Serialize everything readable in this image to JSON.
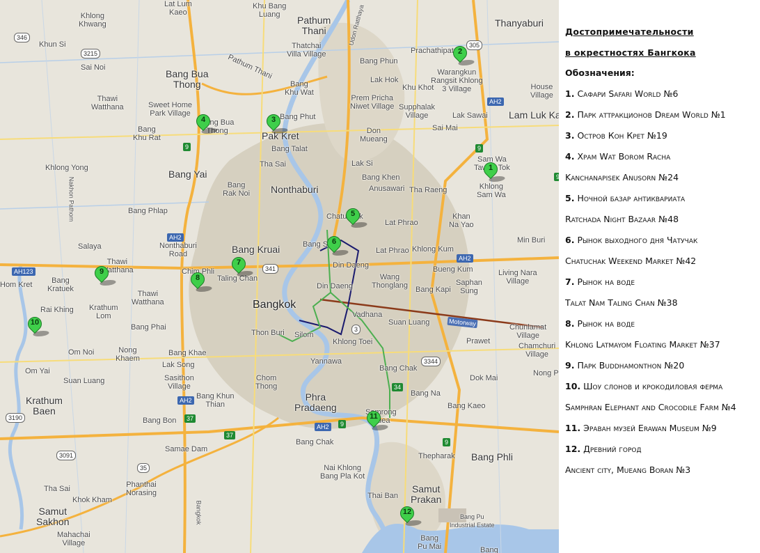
{
  "map": {
    "labels": {
      "lat_lum_kaeo": "Lat Lum\nKaeo",
      "khu_bang_luang": "Khu Bang\nLuang",
      "pathum_thani": "Pathum\nThani",
      "thanyaburi": "Thanyaburi",
      "khlong_khwang": "Khlong\nKhwang",
      "khun_si": "Khun Si",
      "sai_noi": "Sai Noi",
      "thatchai": "Thatchai\nVilla Village",
      "prachathipat": "Prachathipat",
      "bang_bua_thong_1": "Bang Bua\nThong",
      "pathum_thani_road": "Pathum Thani",
      "bang_phun": "Bang Phun",
      "warangkun": "Warangkun\nRangsit Khlong\n3 Village",
      "thawi_watthana_1": "Thawi\nWatthana",
      "sweet_home": "Sweet Home\nPark Village",
      "bang_khu_wat": "Bang\nKhu Wat",
      "lak_hok": "Lak Hok",
      "khu_khot": "Khu Khot",
      "house_village": "House\nVillage",
      "prem_pricha": "Prem Pricha\nNiwet Village",
      "supphalak": "Supphalak\nVillage",
      "lam_luk_ka": "Lam Luk Ka",
      "bang_bua_thong_2": "Bang Bua\nThong",
      "bang_phut": "Bang Phut",
      "pak_kret": "Pak Kret",
      "lak_sawai": "Lak Sawai",
      "bang_khu_rat": "Bang\nKhu Rat",
      "don_mueang": "Don\nMueang",
      "sai_mai": "Sai Mai",
      "bang_talat": "Bang Talat",
      "lak_si": "Lak Si",
      "sam_wa_tawan": "Sam Wa\nTawan Tok",
      "khlong_yong": "Khlong Yong",
      "tha_sai": "Tha Sai",
      "bang_khen": "Bang Khen",
      "bang_yai": "Bang Yai",
      "nonthaburi": "Nonthaburi",
      "anusawari": "Anusawari",
      "khlong_sam_wa": "Khlong\nSam Wa",
      "bang_rak_noi": "Bang\nRak Noi",
      "tha_raeng": "Tha Raeng",
      "bang_phlap": "Bang Phlap",
      "chatuchak": "Chatuchak",
      "lat_phrao_1": "Lat Phrao",
      "khan_na_yao": "Khan\nNa Yao",
      "salaya": "Salaya",
      "nonthaburi_road": "Nonthaburi\nRoad",
      "bang_kruai": "Bang Kruai",
      "bang_sue": "Bang Sue",
      "lat_phrao_2": "Lat Phrao",
      "khlong_kum": "Khlong Kum",
      "min_buri": "Min Buri",
      "thawi_watthana_2": "Thawi\nWatthana",
      "chimphli": "Chim Phli",
      "taling_chan": "Taling Chan",
      "din_daeng_1": "Din Daeng",
      "wang_thonglang": "Wang\nThonglang",
      "bueng_kum": "Bueng Kum",
      "living_nara": "Living Nara\nVillage",
      "hom_kret": "Hom Kret",
      "bang_kratuek": "Bang\nKratuek",
      "thawi_watthana_3": "Thawi\nWatthana",
      "din_daeng_2": "Din Daeng",
      "bang_kapi": "Bang Kapi",
      "saphan_sung": "Saphan\nSung",
      "rai_khing": "Rai Khing",
      "krathum_lom": "Krathum\nLom",
      "bangkok": "Bangkok",
      "vadhana": "Vadhana",
      "suan_luang_1": "Suan Luang",
      "chunlamat": "Chunlamat\nVillage",
      "bang_phai": "Bang Phai",
      "thon_buri": "Thon Buri",
      "silom": "Silom",
      "khlong_toei": "Khlong Toei",
      "prawet": "Prawet",
      "chamchuri": "Chamchuri\nVillage",
      "om_noi": "Om Noi",
      "bang_khae": "Bang Khae",
      "nong_khaem": "Nong\nKhaem",
      "yannawa": "Yannawa",
      "bang_chak": "Bang Chak",
      "nong_pr": "Nong Pr",
      "om_yai": "Om Yai",
      "lak_song": "Lak Song",
      "sasithon": "Sasithon\nVillage",
      "chom_thong": "Chom\nThong",
      "dok_mai": "Dok Mai",
      "suan_luang_2": "Suan Luang",
      "krathum_baen": "Krathum\nBaen",
      "bang_khun_thian": "Bang Khun\nThian",
      "phra_pradaeng": "Phra\nPradaeng",
      "bang_na": "Bang Na",
      "samrong_nuea": "Samrong\nNuea",
      "bang_kaeo": "Bang Kaeo",
      "bang_bon": "Bang Bon",
      "samae_dam": "Samae Dam",
      "bang_chak_2": "Bang Chak",
      "thepharak": "Thepharak",
      "bang_phli": "Bang Phli",
      "nai_khlong": "Nai Khlong\nBang Pla Kot",
      "phanthai": "Phanthai\nNorasing",
      "tha_sai_2": "Tha Sai",
      "samut_prakan": "Samut\nPrakan",
      "khok_kham": "Khok Kham",
      "thai_ban": "Thai Ban",
      "bang_pu": "Bang Pu\nIndustrial Estate",
      "samut_sakhon": "Samut\nSakhon",
      "mahachai": "Mahachai\nVillage",
      "bang_pu_mai": "Bang\nPu Mai",
      "bang_poo": "Bang\nPoo",
      "motorway": "Motorway",
      "udon_ratthaya": "Udon Ratthaya",
      "nakhon_pathom": "Nakhon Pathom",
      "bangkok_road": "Bangkok"
    },
    "shields": {
      "r346": "346",
      "r3215": "3215",
      "r305": "305",
      "r9a": "9",
      "r9b": "9",
      "r9c": "9",
      "rah2a": "AH2",
      "rah2b": "AH2",
      "rah2c": "AH2",
      "rah2d": "AH2",
      "rah2e": "AH2",
      "rah123": "AH123",
      "r341": "341",
      "r3": "3",
      "r3344": "3344",
      "r34": "34",
      "r37a": "37",
      "r37b": "37",
      "r3190": "3190",
      "r3091": "3091",
      "r35": "35",
      "r9d": "9",
      "r9e": "9"
    },
    "markers": [
      "1",
      "2",
      "3",
      "4",
      "5",
      "6",
      "7",
      "8",
      "9",
      "10",
      "11",
      "12"
    ],
    "colors": {
      "water": "#a8c6e8",
      "expressway": "#f4b23e",
      "major_road": "#f7dc7a",
      "urban": "#d9d3c4",
      "marker": "#3fcf4a",
      "rail_purple": "#1a1a6e",
      "rail_green": "#4caf50",
      "rail_brown": "#8b3a1a"
    }
  },
  "legend": {
    "title_1": "Достопримечательности",
    "title_2": "в окрестностях Бангкока",
    "heading": "Обозначения:",
    "items": [
      {
        "n": "1.",
        "text": "Сафари Safari World №6"
      },
      {
        "n": "2.",
        "text": "Парк аттракционов Dream World №1"
      },
      {
        "n": "3.",
        "text": "Остров Кон Крет №19"
      },
      {
        "n": "4.",
        "text": "Храм Wat Borom Racha"
      },
      {
        "n": "",
        "text": "Kanchanapisek Anusorn №24"
      },
      {
        "n": "5.",
        "text": "Ночной базар антиквариата"
      },
      {
        "n": "",
        "text": "Ratchada Night Bazaar №48"
      },
      {
        "n": "6.",
        "text": "Рынок выходного дня Чатучак"
      },
      {
        "n": "",
        "text": "Chatuchak Weekend Market №42"
      },
      {
        "n": "7.",
        "text": "Рынок на воде"
      },
      {
        "n": "",
        "text": "Talat Nam Taling Chan №38"
      },
      {
        "n": "8.",
        "text": "Рынок на воде"
      },
      {
        "n": "",
        "text": "Khlong Latmayom Floating Market №37"
      },
      {
        "n": "9.",
        "text": "Парк Buddhamonthon №20"
      },
      {
        "n": "10.",
        "text": "Шоу слонов и крокодиловая ферма"
      },
      {
        "n": "",
        "text": "Samphran Elephant and Crocodile Farm №4"
      },
      {
        "n": "11.",
        "text": "Эраван музей Erawan Museum №9"
      },
      {
        "n": "12.",
        "text": "Древний город"
      },
      {
        "n": "",
        "text": "Ancient city, Mueang Boran №3"
      }
    ]
  }
}
